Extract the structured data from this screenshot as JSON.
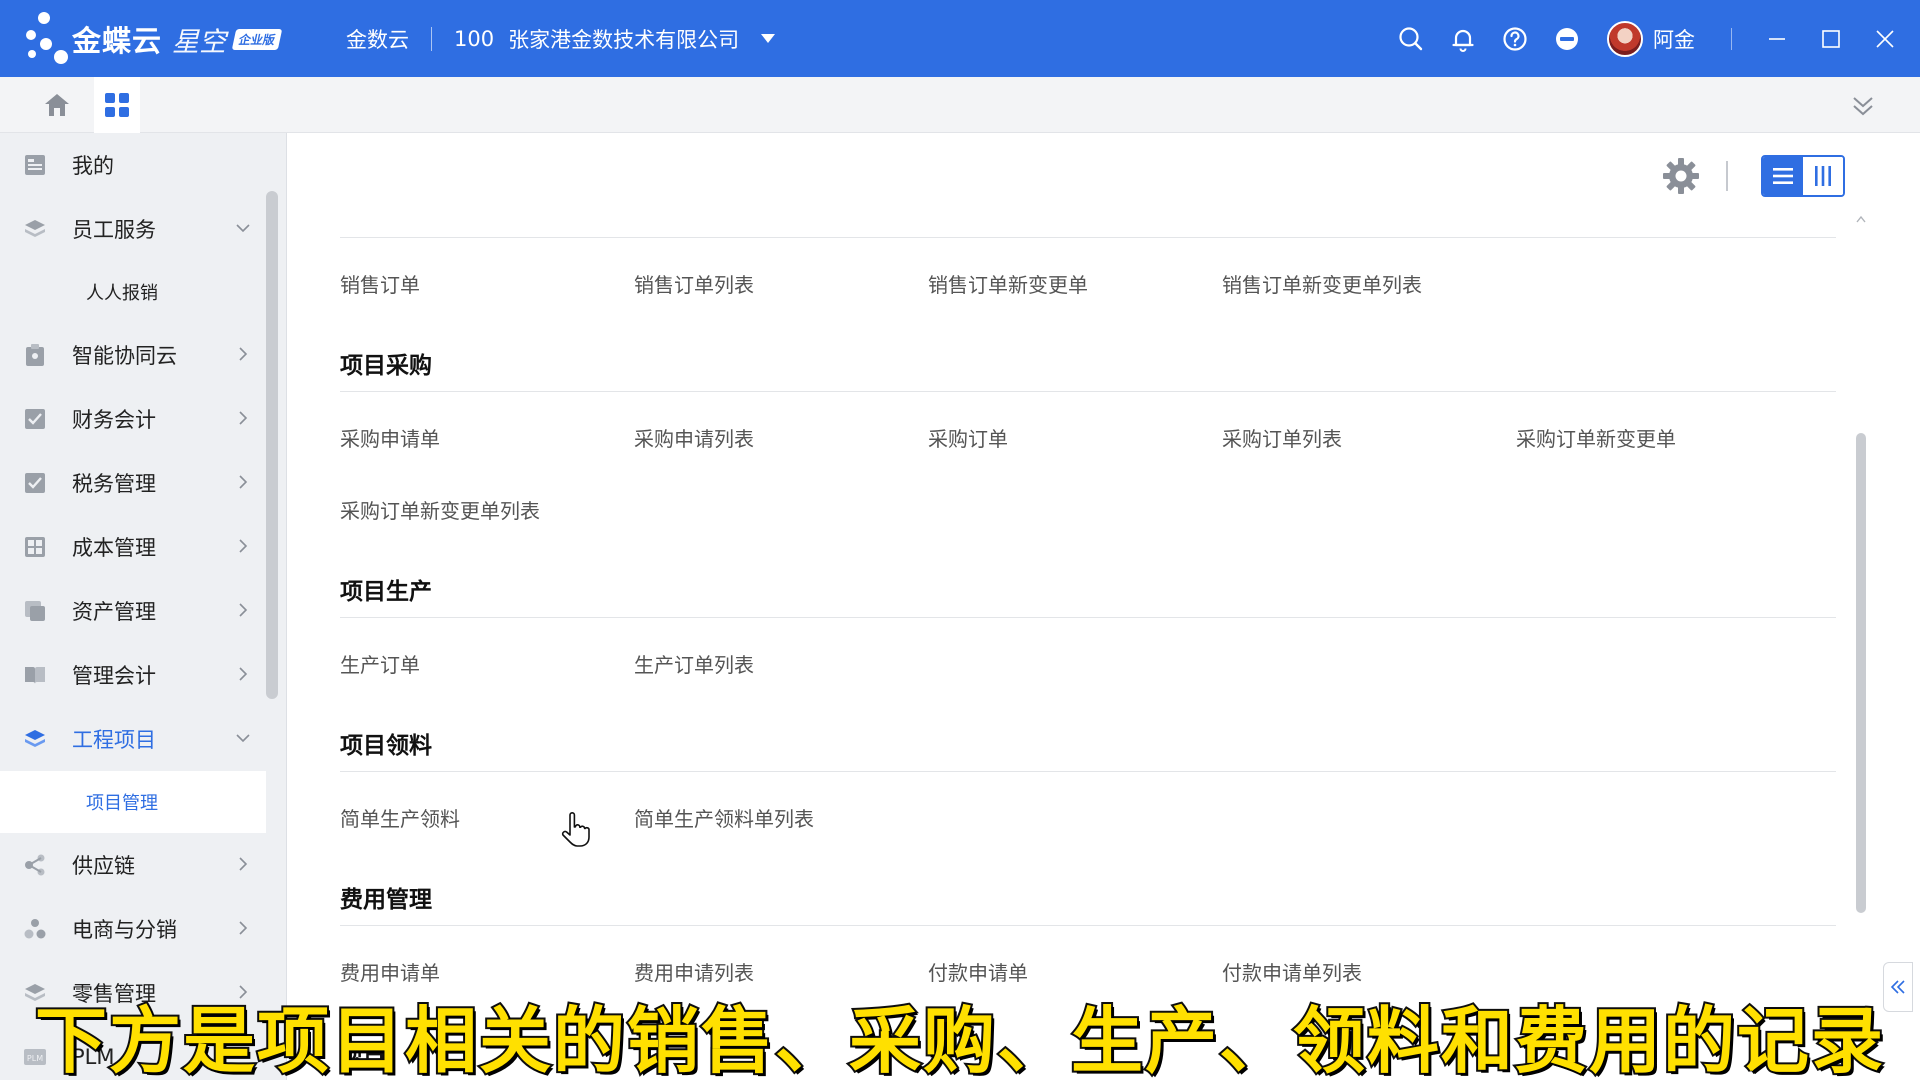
{
  "topbar": {
    "brand": "金蝶云",
    "brand_sub": "星空",
    "edition": "企业版",
    "org_short": "金数云",
    "org_code": "100",
    "org_name": "张家港金数技术有限公司",
    "user_name": "阿金",
    "icons": [
      "search-icon",
      "bell-icon",
      "help-icon",
      "minus-circle-icon"
    ],
    "accent": "#2f6ee2"
  },
  "sidebar": {
    "items": [
      {
        "label": "我的",
        "icon": "dashboard-icon",
        "chevron": "none"
      },
      {
        "label": "员工服务",
        "icon": "layers-icon",
        "chevron": "down"
      },
      {
        "label": "人人报销",
        "sub": true
      },
      {
        "label": "智能协同云",
        "icon": "clipboard-icon",
        "chevron": "right"
      },
      {
        "label": "财务会计",
        "icon": "check-box-icon",
        "chevron": "right"
      },
      {
        "label": "税务管理",
        "icon": "check-box-icon",
        "chevron": "right"
      },
      {
        "label": "成本管理",
        "icon": "grid-icon",
        "chevron": "right"
      },
      {
        "label": "资产管理",
        "icon": "copy-icon",
        "chevron": "right"
      },
      {
        "label": "管理会计",
        "icon": "book-icon",
        "chevron": "right"
      },
      {
        "label": "工程项目",
        "icon": "layers-icon",
        "chevron": "down",
        "active": true
      },
      {
        "label": "项目管理",
        "sub": true,
        "active": true
      },
      {
        "label": "供应链",
        "icon": "share-icon",
        "chevron": "right"
      },
      {
        "label": "电商与分销",
        "icon": "cluster-icon",
        "chevron": "right"
      },
      {
        "label": "零售管理",
        "icon": "layers-icon",
        "chevron": "right"
      },
      {
        "label": "PLM",
        "icon": "plm-icon",
        "chevron": "none"
      }
    ]
  },
  "main": {
    "sections": [
      {
        "title": "",
        "links": [
          "销售订单",
          "销售订单列表",
          "销售订单新变更单",
          "销售订单新变更单列表"
        ]
      },
      {
        "title": "项目采购",
        "links": [
          "采购申请单",
          "采购申请列表",
          "采购订单",
          "采购订单列表",
          "采购订单新变更单",
          "采购订单新变更单列表"
        ]
      },
      {
        "title": "项目生产",
        "links": [
          "生产订单",
          "生产订单列表"
        ]
      },
      {
        "title": "项目领料",
        "links": [
          "简单生产领料",
          "简单生产领料单列表"
        ]
      },
      {
        "title": "费用管理",
        "links": [
          "费用申请单",
          "费用申请列表",
          "付款申请单",
          "付款申请单列表"
        ]
      }
    ],
    "partial_bottom_label": "项目"
  },
  "subtitle": "下方是项目相关的销售、采购、生产、领料和费用的记录"
}
